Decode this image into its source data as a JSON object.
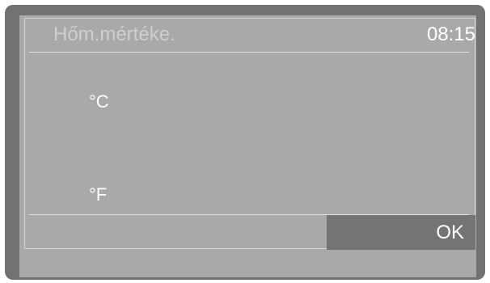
{
  "header": {
    "title": "Hőm.mértéke.",
    "time": "08:15"
  },
  "options": [
    {
      "label": "°C"
    },
    {
      "label": "°F"
    }
  ],
  "footer": {
    "ok_label": "OK"
  },
  "colors": {
    "frame": "#727272",
    "screen": "#a9a9a9",
    "ok_button": "#747474",
    "text": "#ffffff",
    "title_text": "#cfcfcf"
  }
}
